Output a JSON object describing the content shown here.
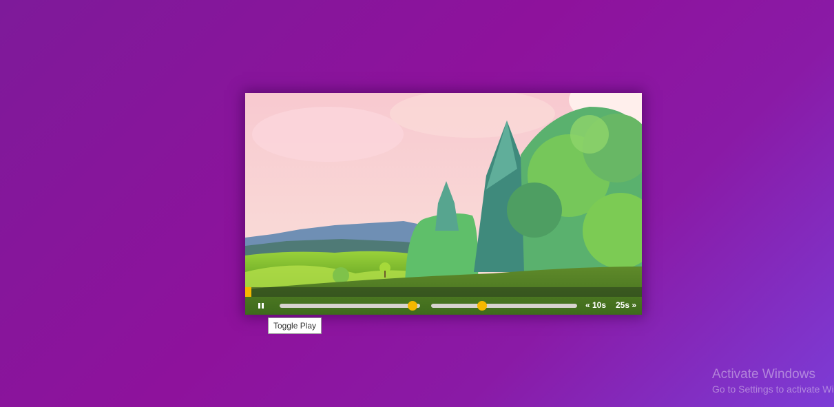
{
  "player": {
    "progress_fraction": 0.015,
    "volume_fraction": 0.98,
    "playback_rate_fraction": 0.34,
    "skip_back_label": "« 10s",
    "skip_forward_label": "25s »",
    "play_state": "playing",
    "tooltip_text": "Toggle Play"
  },
  "watermark": {
    "title": "Activate Windows",
    "subtitle": "Go to Settings to activate Windows."
  },
  "colors": {
    "accent": "#f5b800",
    "background_start": "#7e1a9a",
    "background_end": "#7c3cd6"
  },
  "icons": {
    "play_button": "pause-icon"
  }
}
